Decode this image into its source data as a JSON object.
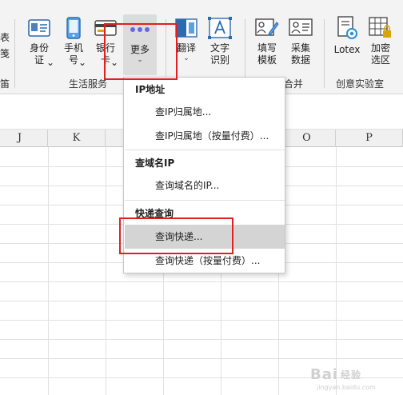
{
  "ribbon": {
    "partial_left": {
      "top": "表",
      "bottom": "笺",
      "group_fragment": "笛"
    },
    "buttons": [
      {
        "name": "id-card-button",
        "icon": "id-card-icon",
        "label": "身份\n证",
        "caret": "⌄"
      },
      {
        "name": "phone-number-button",
        "icon": "mobile-phone-icon",
        "label": "手机\n号",
        "caret": "⌄"
      },
      {
        "name": "bank-card-button",
        "icon": "bank-card-icon",
        "label": "银行\n卡",
        "caret": "⌄"
      },
      {
        "name": "more-button",
        "icon": "more-dots-icon",
        "label": "更多",
        "caret": "⌄"
      },
      {
        "name": "translate-button",
        "icon": "translate-icon",
        "label": "翻译",
        "caret": "⌄"
      },
      {
        "name": "text-recognition-button",
        "icon": "text-ocr-icon",
        "label": "文字\n识别",
        "caret": ""
      },
      {
        "name": "fill-template-button",
        "icon": "fill-template-icon",
        "label": "填写\n模板",
        "caret": ""
      },
      {
        "name": "collect-data-button",
        "icon": "collect-data-icon",
        "label": "采集\n数据",
        "caret": ""
      },
      {
        "name": "lotex-button",
        "icon": "lotex-gear-icon",
        "label": "Lotex",
        "caret": ""
      },
      {
        "name": "encrypt-region-button",
        "icon": "encrypt-grid-icon",
        "label": "加密\n选区",
        "caret": ""
      }
    ],
    "groups": {
      "life_services": "生活服务",
      "merge_fragment": "合并",
      "creative_lab": "创意实验室"
    }
  },
  "grid": {
    "columns": [
      "J",
      "K",
      "",
      "",
      "",
      "O",
      "P"
    ]
  },
  "menu": {
    "sections": [
      {
        "title": "IP地址",
        "items": [
          "查IP归属地...",
          "查IP归属地（按量付费）..."
        ]
      },
      {
        "title": "查域名IP",
        "items": [
          "查询域名的IP..."
        ]
      },
      {
        "title": "快递查询",
        "items": [
          "查询快递...",
          "查询快递（按量付费）..."
        ]
      }
    ],
    "active_item": "查询快递..."
  },
  "watermark": {
    "text": "Bai",
    "text2": "经验",
    "sub": "jingyan.baidu.com"
  },
  "colors": {
    "annotation_red": "#e02020",
    "more_dots": "#5b6ee1",
    "menu_highlight": "#d4d4d4"
  }
}
